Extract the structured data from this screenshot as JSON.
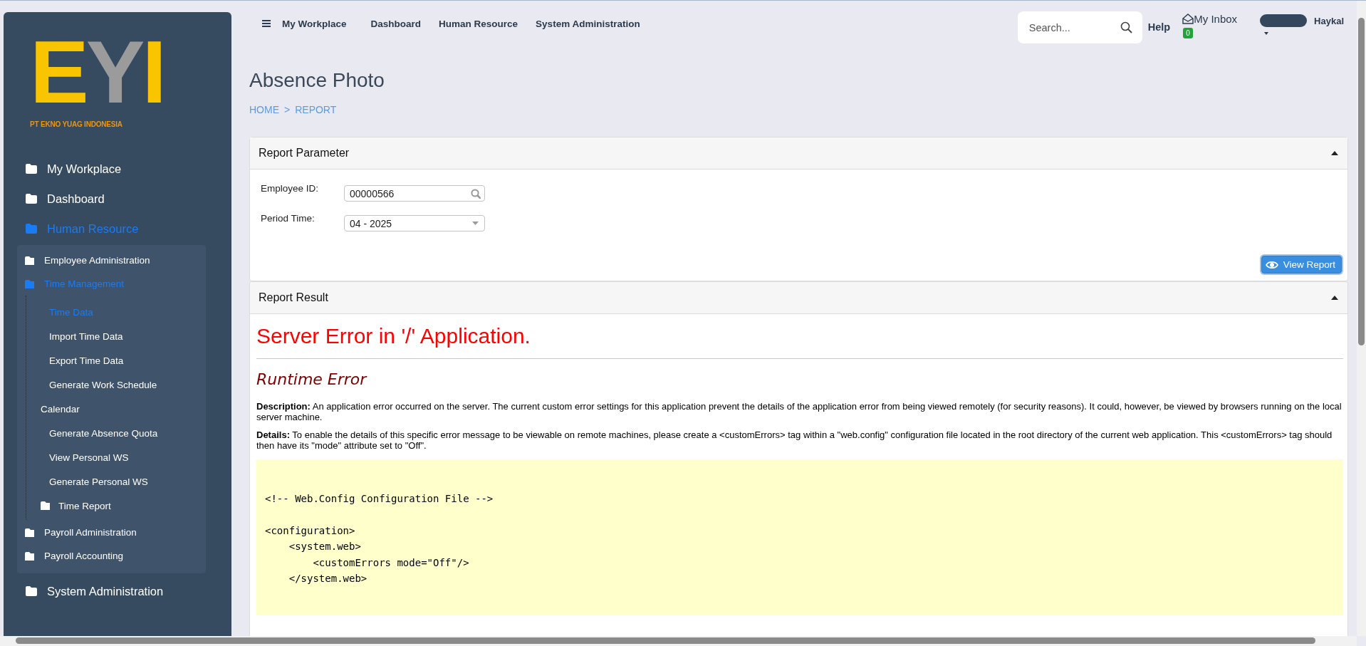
{
  "sidebar": {
    "logo": {
      "mark": "EYI",
      "company": "PT EKNO YUAG INDONESIA"
    },
    "menu": [
      {
        "label": "My Workplace",
        "kind": "folder",
        "selected": false
      },
      {
        "label": "Dashboard",
        "kind": "folder",
        "selected": false
      },
      {
        "label": "Human Resource",
        "kind": "folder",
        "selected": true,
        "children": [
          {
            "label": "Employee Administration",
            "kind": "folder",
            "selected": false
          },
          {
            "label": "Time Management",
            "kind": "folder",
            "selected": true,
            "children": [
              {
                "label": "Time Data",
                "kind": "page",
                "selected": true
              },
              {
                "label": "Import Time Data",
                "kind": "page",
                "selected": false
              },
              {
                "label": "Export Time Data",
                "kind": "page",
                "selected": false
              },
              {
                "label": "Generate Work Schedule",
                "kind": "page",
                "selected": false
              },
              {
                "label": "Calendar",
                "kind": "group",
                "selected": false
              },
              {
                "label": "Generate Absence Quota",
                "kind": "page",
                "selected": false
              },
              {
                "label": "View Personal WS",
                "kind": "page",
                "selected": false
              },
              {
                "label": "Generate Personal WS",
                "kind": "page",
                "selected": false
              },
              {
                "label": "Time Report",
                "kind": "folder",
                "selected": false
              }
            ]
          },
          {
            "label": "Payroll Administration",
            "kind": "folder",
            "selected": false
          },
          {
            "label": "Payroll Accounting",
            "kind": "folder",
            "selected": false
          }
        ]
      },
      {
        "label": "System Administration",
        "kind": "folder",
        "selected": false
      }
    ]
  },
  "top_nav": {
    "items": [
      "My Workplace",
      "Dashboard",
      "Human Resource",
      "System Administration"
    ],
    "search": {
      "placeholder": "Search..."
    },
    "help": "Help",
    "inbox": {
      "label": "My Inbox",
      "count": "0"
    },
    "user": {
      "name": "Haykal"
    }
  },
  "page": {
    "title": "Absence Photo",
    "breadcrumb": [
      "HOME",
      "REPORT"
    ],
    "separator": ">"
  },
  "report_parameter": {
    "title": "Report Parameter",
    "expanded": true,
    "fields": [
      {
        "label": "Employee ID:",
        "value": "00000566",
        "kind": "lookup"
      },
      {
        "label": "Period Time:",
        "value": "04 - 2025",
        "kind": "select"
      }
    ],
    "button": "View Report"
  },
  "report_result": {
    "title": "Report Result",
    "expanded": true,
    "error": {
      "heading": "Server Error in '/' Application.",
      "subheading": "Runtime Error",
      "paragraphs": [
        "**Description:** An application error occurred on the server. The current custom error settings for this application prevent the details of the application error from being viewed remotely (for security reasons). It could, however, be viewed by browsers running on the local server machine.",
        "**Details:** To enable the details of this specific error message to be viewable on remote machines, please create a <customErrors> tag within a \"web.config\" configuration file located in the root directory of the current web application. This <customErrors> tag should then have its \"mode\" attribute set to \"Off\"."
      ],
      "code_blocks": [
        [
          "<!-- Web.Config Configuration File -->"
        ],
        [
          "<configuration>",
          "    <system.web>",
          "        <customErrors mode=\"Off\"/>",
          "    </system.web>"
        ]
      ]
    }
  }
}
